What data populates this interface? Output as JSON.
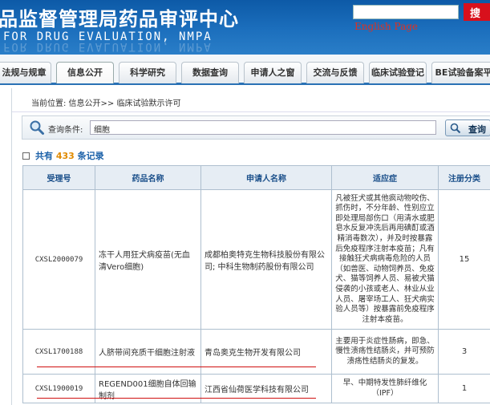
{
  "header": {
    "title_cn": "品监督管理局药品审评中心",
    "title_en": "FOR  DRUG EVALUATION,  NMPA",
    "search_button": "搜",
    "english_link": "English Page",
    "search_value": ""
  },
  "nav": {
    "tabs": [
      {
        "label": "法规与规章",
        "active": false
      },
      {
        "label": "信息公开",
        "active": true
      },
      {
        "label": "科学研究",
        "active": false
      },
      {
        "label": "数据查询",
        "active": false
      },
      {
        "label": "申请人之窗",
        "active": false
      },
      {
        "label": "交流与反馈",
        "active": false
      },
      {
        "label": "临床试验登记",
        "active": false
      },
      {
        "label": "BE试验备案平",
        "active": false
      }
    ]
  },
  "breadcrumb": "当前位置: 信息公开>> 临床试验默示许可",
  "query": {
    "label": "查询条件:",
    "value": "细胞",
    "button": "查询"
  },
  "record_count": {
    "prefix": "共有",
    "count": "433",
    "suffix": "条记录"
  },
  "table": {
    "columns": [
      "受理号",
      "药品名称",
      "申请人名称",
      "适应症",
      "注册分类"
    ],
    "rows": [
      {
        "id": "CXSL2000079",
        "drug": "冻干人用狂犬病疫苗(无血清Vero细胞)",
        "applicant": "成都柏奥特克生物科技股份有限公司; 中科生物制药股份有限公司",
        "indication": "凡被狂犬或其他疯动物咬伤、抓伤时，不分年龄、性别应立即处理局部伤口（用清水或肥皂水反复冲洗后再用碘酊或酒精消毒数次），并及时按暴露后免疫程序注射本疫苗；凡有接触狂犬病病毒危险的人员（如兽医、动物饲养员、免疫犬、猫等饲养人员、易被犬猫侵袭的小孩或老人、林业从业人员、屠宰场工人、狂犬病实验人员等）按暴露前免疫程序注射本疫苗。",
        "category": "15"
      },
      {
        "id": "CXSL1700188",
        "drug": "人脐带间充质干细胞注射液",
        "applicant": "青岛奥克生物开发有限公司",
        "indication": "主要用于炎症性肠病，即急、慢性溃疡性结肠炎，并可预防溃疡性结肠炎的复发。",
        "category": "3"
      },
      {
        "id": "CXSL1900019",
        "drug": "REGEND001细胞自体回输制剂",
        "applicant": "江西省仙荷医学科技有限公司",
        "indication": "早、中期特发性肺纤维化（IPF）",
        "category": "1"
      }
    ]
  }
}
